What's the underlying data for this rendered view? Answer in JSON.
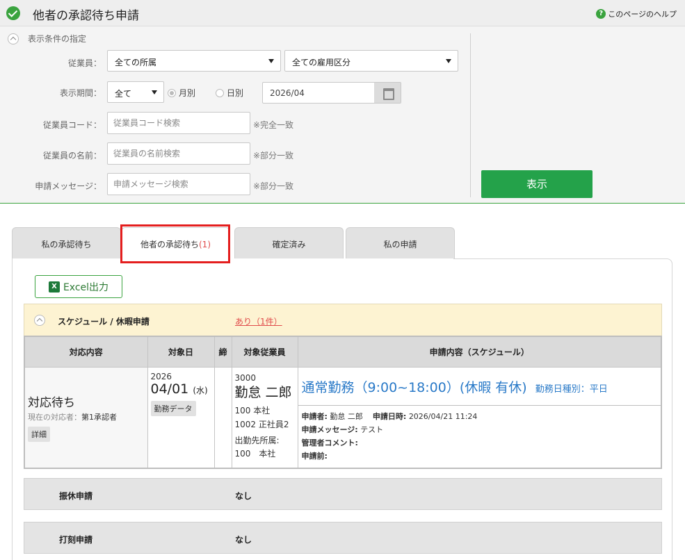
{
  "page": {
    "title": "他者の承認待ち申請",
    "help_label": "このページのヘルプ"
  },
  "filter": {
    "section_label": "表示条件の指定",
    "employee_label": "従業員：",
    "dept_select": "全ての所属",
    "employment_select": "全ての雇用区分",
    "period_label": "表示期間：",
    "period_select": "全て",
    "radio_monthly": "月別",
    "radio_daily": "日別",
    "month_value": "2026/04",
    "code_label": "従業員コード：",
    "code_placeholder": "従業員コード検索",
    "code_hint": "※完全一致",
    "name_label": "従業員の名前：",
    "name_placeholder": "従業員の名前検索",
    "name_hint": "※部分一致",
    "msg_label": "申請メッセージ：",
    "msg_placeholder": "申請メッセージ検索",
    "msg_hint": "※部分一致",
    "show_button": "表示"
  },
  "tabs": [
    {
      "label": "私の承認待ち"
    },
    {
      "label": "他者の承認待ち",
      "count": "(1)"
    },
    {
      "label": "確定済み"
    },
    {
      "label": "私の申請"
    }
  ],
  "excel_label": "Excel出力",
  "schedule": {
    "title": "スケジュール / 休暇申請",
    "count": "あり（1件）",
    "headers": [
      "対応内容",
      "対象日",
      "締",
      "対象従業員",
      "申請内容（スケジュール）"
    ],
    "row": {
      "status": "対応待ち",
      "handler_label": "現在の対応者：",
      "handler": "第1承認者",
      "detail_button": "詳細",
      "year": "2026",
      "date": "04/01",
      "weekday": "(水)",
      "data_button": "勤務データ",
      "emp_code": "3000",
      "emp_name": "勤怠 二郎",
      "dept": "100 本社",
      "employment": "1002 正社員2",
      "work_label": "出勤先所属:",
      "work_dept": "100　本社",
      "content": "通常勤務（9:00~18:00）(休暇 有休)",
      "day_kind": "勤務日種別：平日",
      "applicant_label": "申請者:",
      "applicant": "勤怠 二郎",
      "apply_time_label": "申請日時:",
      "apply_time": "2026/04/21 11:24",
      "message_label": "申請メッセージ:",
      "message": "テスト",
      "admin_comment_label": "管理者コメント:",
      "before_label": "申請前:"
    }
  },
  "transfer": {
    "title": "振休申請",
    "value": "なし"
  },
  "punch": {
    "title": "打刻申請",
    "value": "なし"
  }
}
